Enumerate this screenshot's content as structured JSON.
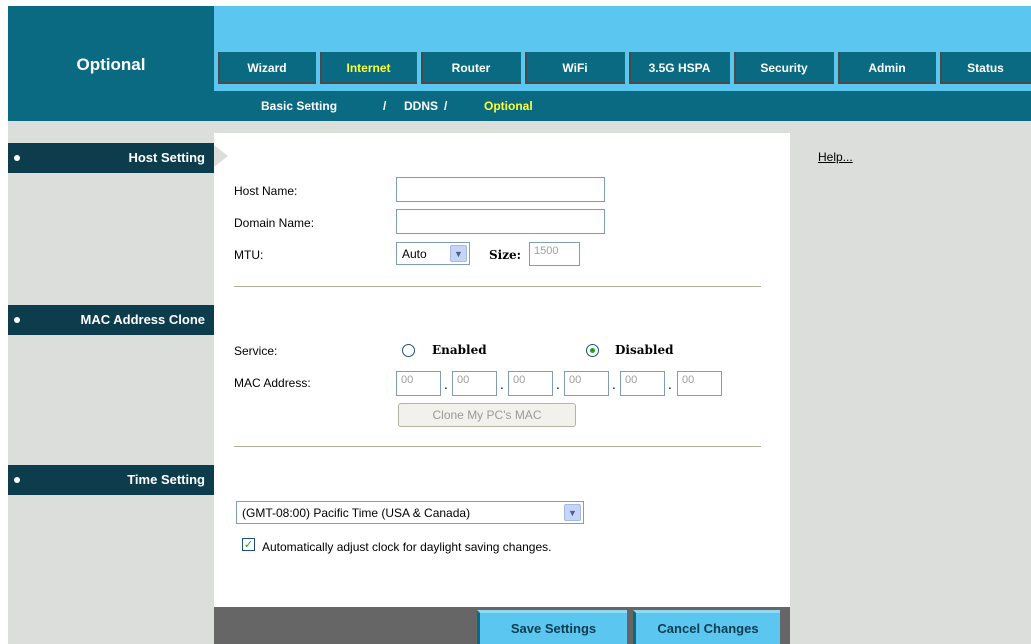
{
  "page_title": "Optional",
  "tabs": [
    {
      "label": "Wizard",
      "active": false
    },
    {
      "label": "Internet",
      "active": true
    },
    {
      "label": "Router",
      "active": false
    },
    {
      "label": "WiFi",
      "active": false
    },
    {
      "label": "3.5G HSPA",
      "active": false
    },
    {
      "label": "Security",
      "active": false
    },
    {
      "label": "Admin",
      "active": false
    },
    {
      "label": "Status",
      "active": false
    }
  ],
  "subnav": {
    "items": [
      "Basic Setting",
      "DDNS",
      "Optional"
    ],
    "separator": "/",
    "active": "Optional"
  },
  "sections": {
    "host_setting": "Host Setting",
    "mac_clone": "MAC Address Clone",
    "time_setting": "Time Setting"
  },
  "help_link": "Help...",
  "host": {
    "host_name_label": "Host Name:",
    "host_name_value": "",
    "domain_name_label": "Domain Name:",
    "domain_name_value": "",
    "mtu_label": "MTU:",
    "mtu_value": "Auto",
    "size_label": "Size:",
    "size_value": "1500"
  },
  "mac": {
    "service_label": "Service:",
    "enabled_label": "Enabled",
    "disabled_label": "Disabled",
    "selected": "Disabled",
    "address_label": "MAC Address:",
    "octets": [
      "00",
      "00",
      "00",
      "00",
      "00",
      "00"
    ],
    "octet_separator": ".",
    "clone_button": "Clone My PC's MAC"
  },
  "time": {
    "timezone_value": "(GMT-08:00) Pacific Time (USA & Canada)",
    "dst_label": "Automatically adjust clock for daylight saving changes.",
    "dst_checked": true
  },
  "buttons": {
    "save": "Save Settings",
    "cancel": "Cancel Changes"
  },
  "colors": {
    "header_light": "#5bc6f0",
    "header_dark": "#0a6a82",
    "section_dark": "#0d3c4d",
    "active_text": "#ffff33",
    "panel_gray": "#dcdedc"
  }
}
